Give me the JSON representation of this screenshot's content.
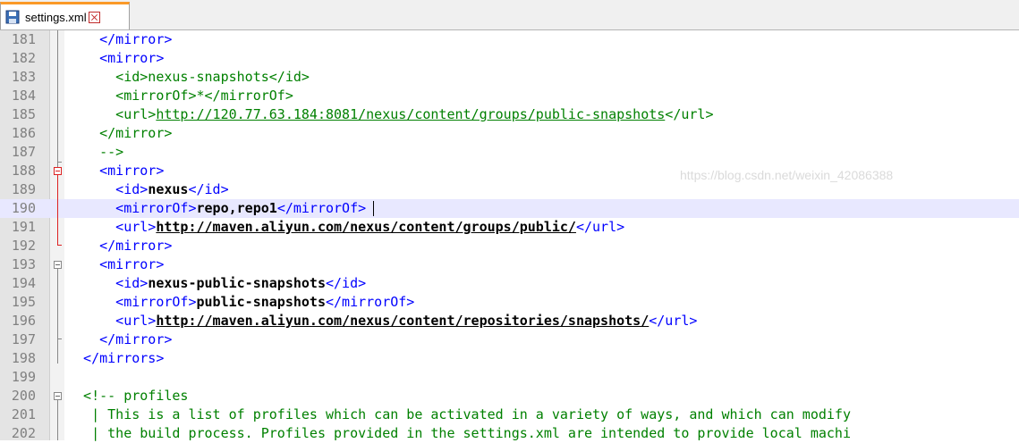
{
  "tab": {
    "label": "settings.xml",
    "icons": [
      "save-icon",
      "close-icon"
    ]
  },
  "watermark": "https://blog.csdn.net/weixin_42086388",
  "lines": [
    {
      "n": "181",
      "parts": [
        {
          "k": "tag",
          "t": "    </mirror>"
        }
      ]
    },
    {
      "n": "182",
      "parts": [
        {
          "k": "tag",
          "t": "    <mirror>"
        }
      ]
    },
    {
      "n": "183",
      "parts": [
        {
          "k": "cmt",
          "t": "      <id>nexus-snapshots</id>"
        }
      ]
    },
    {
      "n": "184",
      "parts": [
        {
          "k": "cmt",
          "t": "      <mirrorOf>*</mirrorOf>"
        }
      ]
    },
    {
      "n": "185",
      "parts": [
        {
          "k": "cmt",
          "t": "      <url>"
        },
        {
          "k": "cmt-url",
          "t": "http://120.77.63.184:8081/nexus/content/groups/public-snapshots"
        },
        {
          "k": "cmt",
          "t": "</url>"
        }
      ]
    },
    {
      "n": "186",
      "parts": [
        {
          "k": "cmt",
          "t": "    </mirror>"
        }
      ]
    },
    {
      "n": "187",
      "parts": [
        {
          "k": "cmt",
          "t": "    -->"
        }
      ]
    },
    {
      "n": "188",
      "parts": [
        {
          "k": "tag",
          "t": "    <mirror>"
        }
      ]
    },
    {
      "n": "189",
      "parts": [
        {
          "k": "tag",
          "t": "      <id>"
        },
        {
          "k": "txt",
          "t": "nexus"
        },
        {
          "k": "tag",
          "t": "</id>"
        }
      ]
    },
    {
      "n": "190",
      "current": true,
      "parts": [
        {
          "k": "tag",
          "t": "      <mirrorOf>"
        },
        {
          "k": "txt",
          "t": "repo,repo1"
        },
        {
          "k": "tag",
          "t": "</mirrorOf>"
        }
      ]
    },
    {
      "n": "191",
      "parts": [
        {
          "k": "tag",
          "t": "      <url>"
        },
        {
          "k": "url",
          "t": "http://maven.aliyun.com/nexus/content/groups/public/"
        },
        {
          "k": "tag",
          "t": "</url>"
        }
      ]
    },
    {
      "n": "192",
      "parts": [
        {
          "k": "tag",
          "t": "    </mirror>"
        }
      ]
    },
    {
      "n": "193",
      "parts": [
        {
          "k": "tag",
          "t": "    <mirror>"
        }
      ]
    },
    {
      "n": "194",
      "parts": [
        {
          "k": "tag",
          "t": "      <id>"
        },
        {
          "k": "txt",
          "t": "nexus-public-snapshots"
        },
        {
          "k": "tag",
          "t": "</id>"
        }
      ]
    },
    {
      "n": "195",
      "parts": [
        {
          "k": "tag",
          "t": "      <mirrorOf>"
        },
        {
          "k": "txt",
          "t": "public-snapshots"
        },
        {
          "k": "tag",
          "t": "</mirrorOf>"
        }
      ]
    },
    {
      "n": "196",
      "parts": [
        {
          "k": "tag",
          "t": "      <url>"
        },
        {
          "k": "url",
          "t": "http://maven.aliyun.com/nexus/content/repositories/snapshots/"
        },
        {
          "k": "tag",
          "t": "</url>"
        }
      ]
    },
    {
      "n": "197",
      "parts": [
        {
          "k": "tag",
          "t": "    </mirror>"
        }
      ]
    },
    {
      "n": "198",
      "parts": [
        {
          "k": "tag",
          "t": "  </mirrors>"
        }
      ]
    },
    {
      "n": "199",
      "parts": []
    },
    {
      "n": "200",
      "parts": [
        {
          "k": "cmt",
          "t": "  <!-- profiles"
        }
      ]
    },
    {
      "n": "201",
      "parts": [
        {
          "k": "cmt",
          "t": "   | This is a list of profiles which can be activated in a variety of ways, and which can modify"
        }
      ]
    },
    {
      "n": "202",
      "parts": [
        {
          "k": "cmt",
          "t": "   | the build process. Profiles provided in the settings.xml are intended to provide local machi"
        }
      ]
    }
  ]
}
